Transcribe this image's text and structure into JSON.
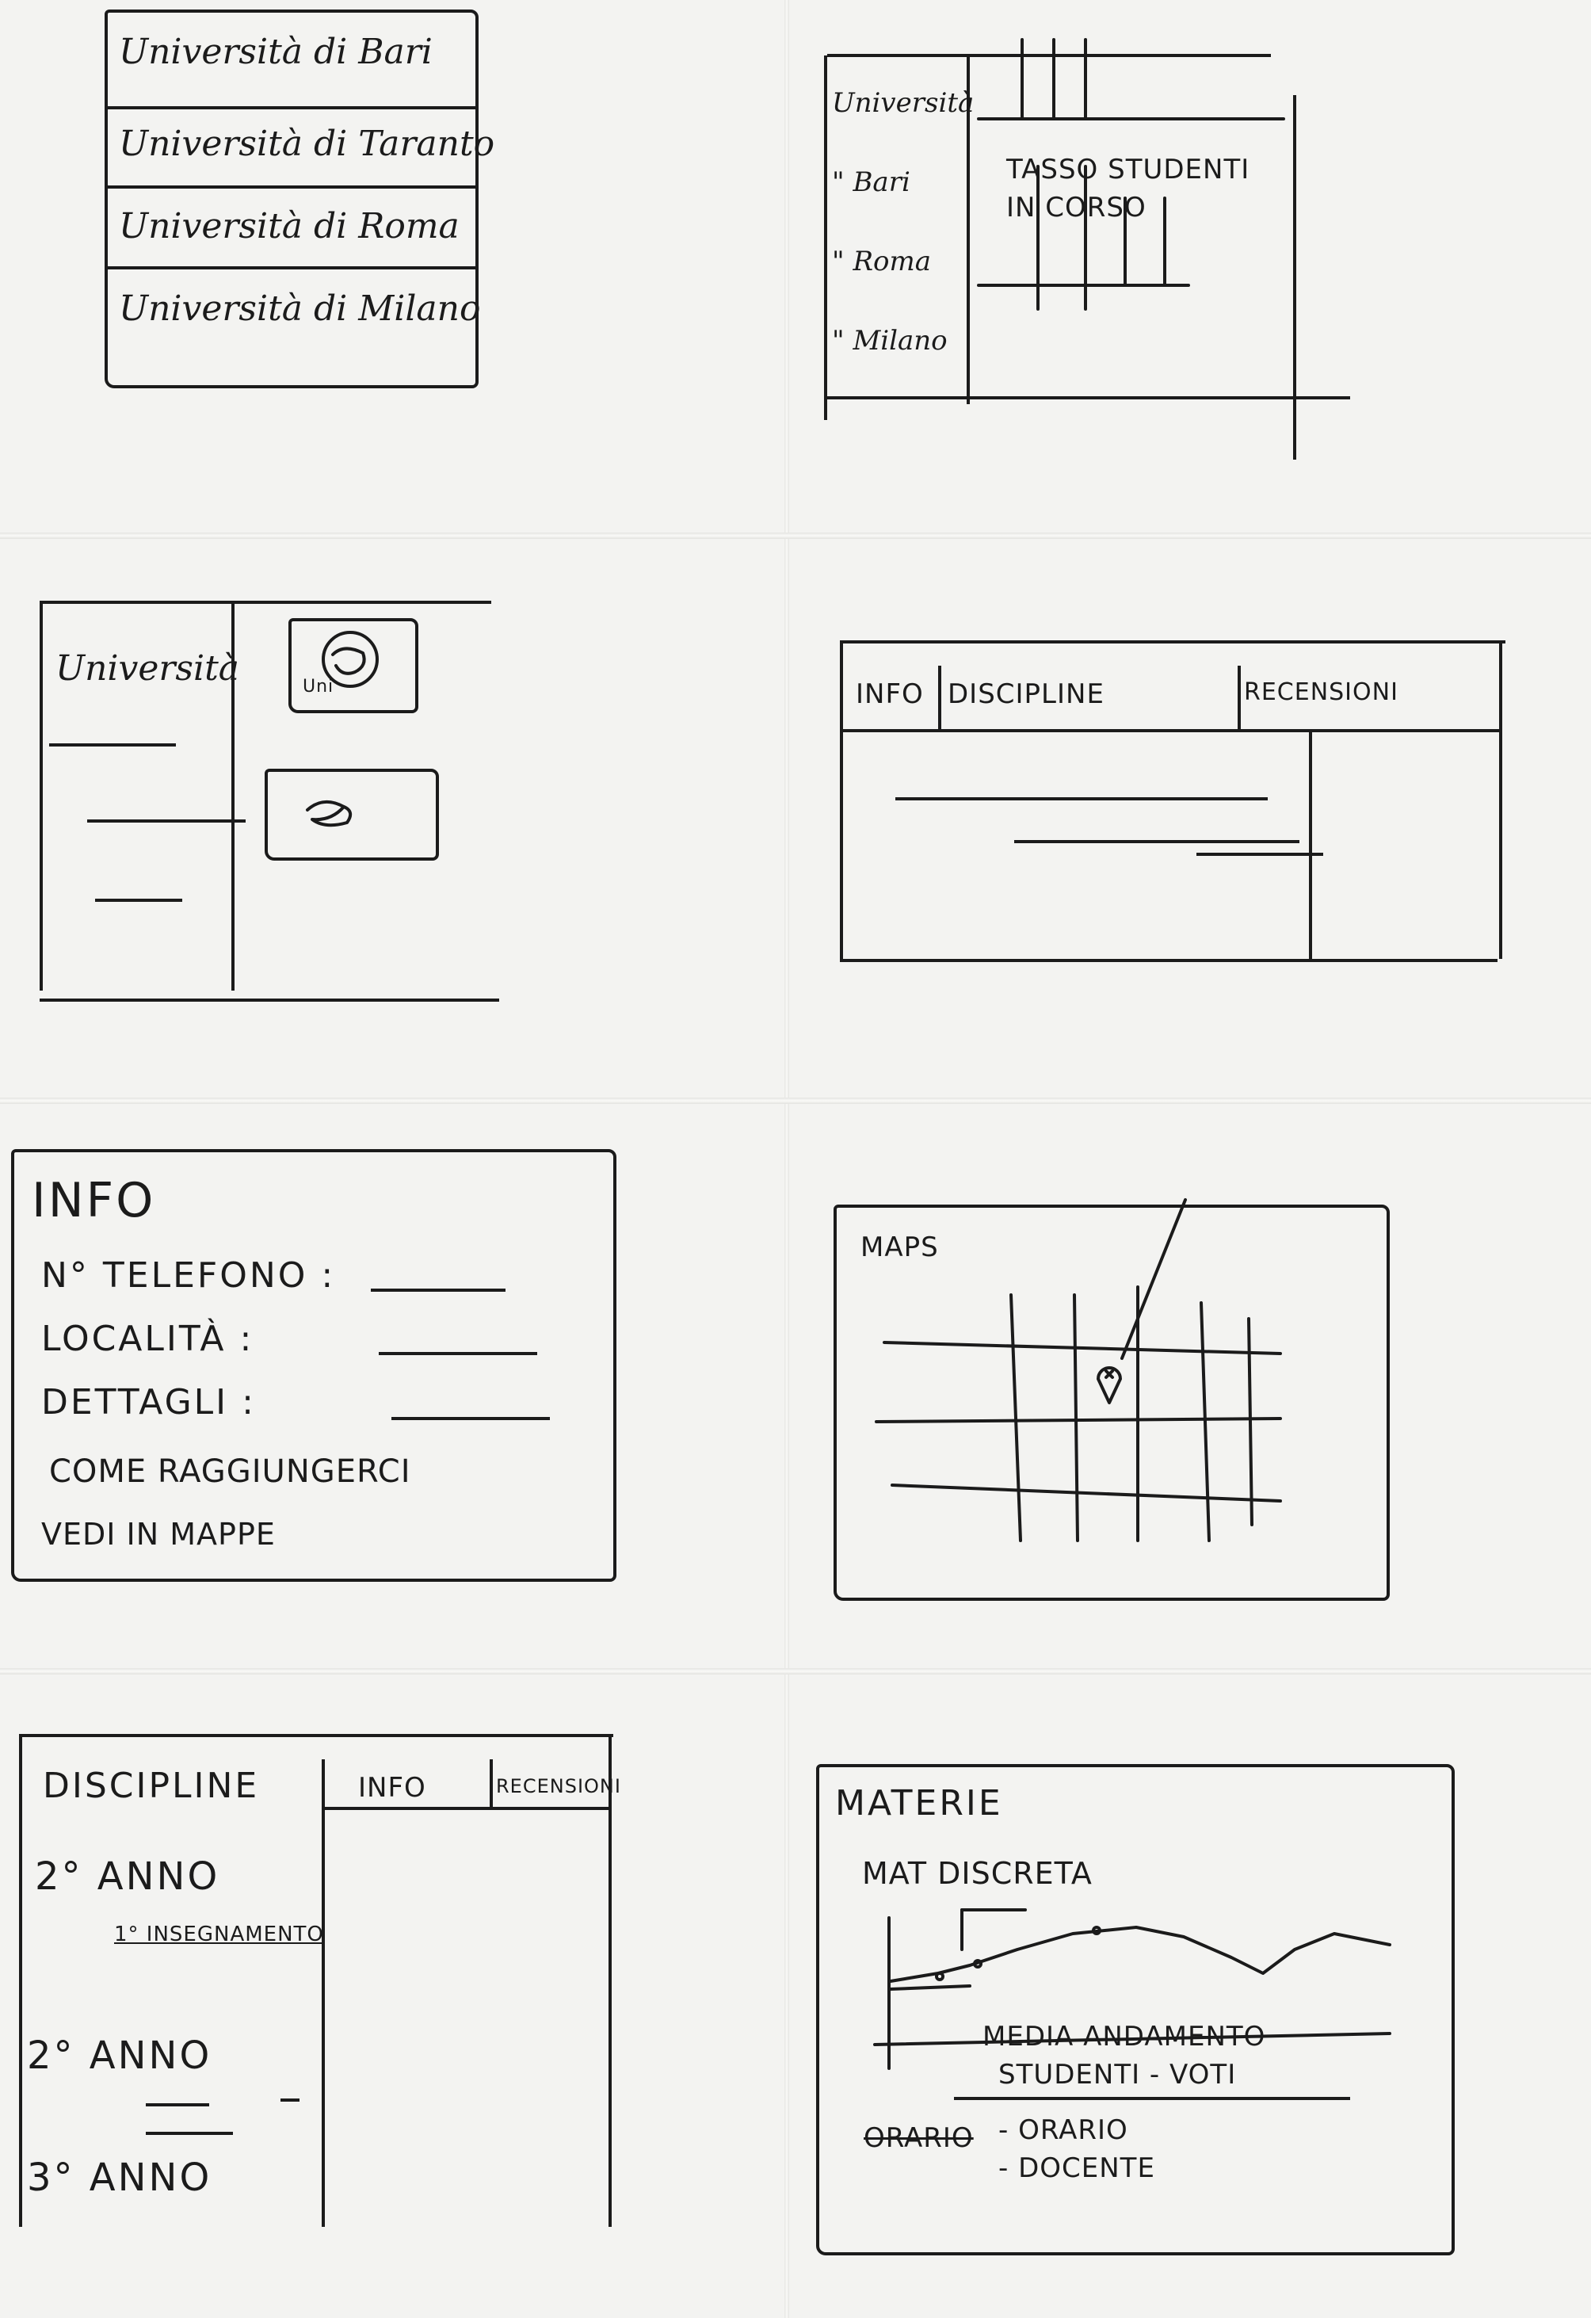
{
  "panel1": {
    "items": [
      "Università di Bari",
      "Università di Taranto",
      "Università di Roma",
      "Università di Milano"
    ]
  },
  "panel2": {
    "list": [
      "Università",
      "\" Bari",
      "\" Roma",
      "\" Milano"
    ],
    "chart_title": "TASSO STUDENTI IN CORSO"
  },
  "panel3": {
    "title": "Università",
    "thumb_caption": "Uni"
  },
  "panel4": {
    "tabs": [
      "INFO",
      "DISCIPLINE",
      "RECENSIONI"
    ]
  },
  "panel5": {
    "title": "INFO",
    "fields": [
      {
        "label": "N° TELEFONO :"
      },
      {
        "label": "LOCALITÀ :"
      },
      {
        "label": "DETTAGLI :"
      }
    ],
    "links": [
      "COME RAGGIUNGERCI",
      "VEDI IN MAPPE"
    ]
  },
  "panel6": {
    "title": "MAPS",
    "icons": {
      "pin": "map-pin-icon"
    }
  },
  "panel7": {
    "title": "DISCIPLINE",
    "tabs": [
      "INFO",
      "RECENSIONI"
    ],
    "years": [
      {
        "label": "2° ANNO",
        "sub": "1° INSEGNAMENTO"
      },
      {
        "label": "2° ANNO",
        "sub": ""
      },
      {
        "label": "3° ANNO",
        "sub": ""
      }
    ]
  },
  "panel8": {
    "title": "MATERIE",
    "subject": "MAT DISCRETA",
    "chart_caption_1": "MEDIA ANDAMENTO",
    "chart_caption_2": "STUDENTI - VOTI",
    "struck": "ORARIO",
    "items": [
      "- ORARIO",
      "- DOCENTE"
    ]
  }
}
